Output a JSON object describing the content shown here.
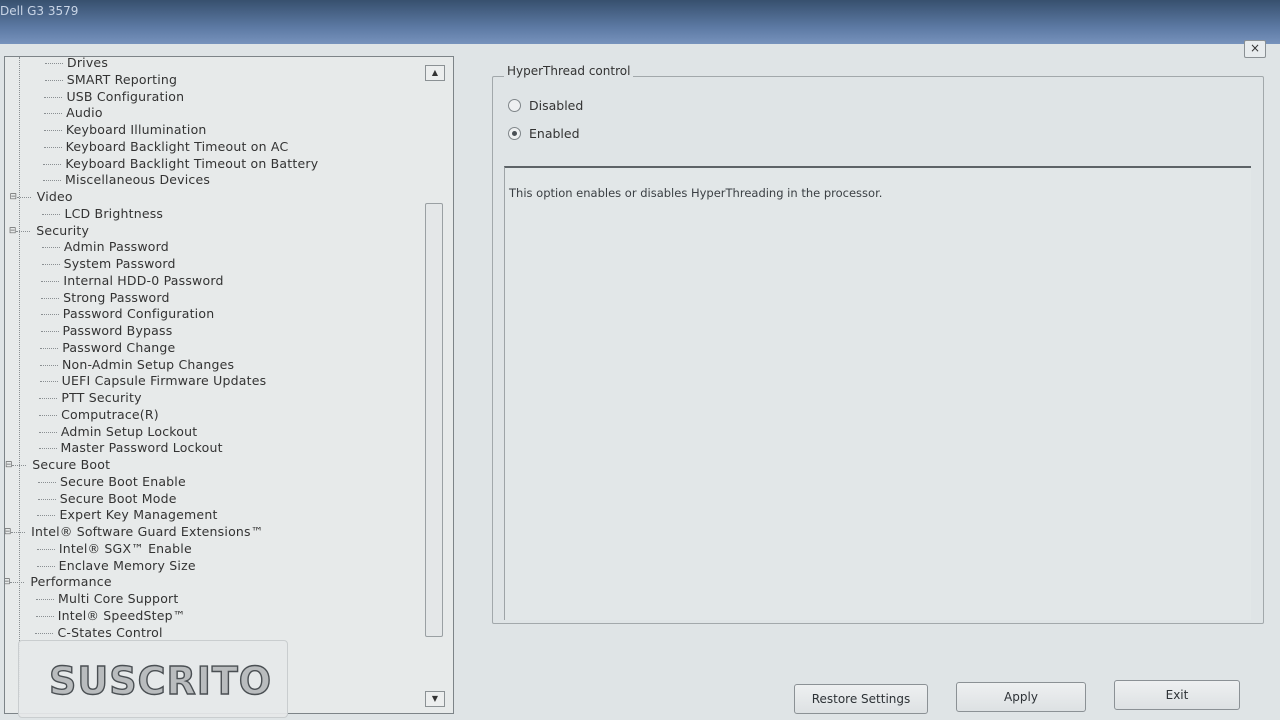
{
  "window": {
    "title": "Dell G3 3579",
    "close_glyph": "×"
  },
  "tree": {
    "items": [
      {
        "label": "Drives",
        "level": 2
      },
      {
        "label": "SMART Reporting",
        "level": 2
      },
      {
        "label": "USB Configuration",
        "level": 2
      },
      {
        "label": "Audio",
        "level": 2
      },
      {
        "label": "Keyboard Illumination",
        "level": 2
      },
      {
        "label": "Keyboard Backlight Timeout on AC",
        "level": 2
      },
      {
        "label": "Keyboard Backlight Timeout on Battery",
        "level": 2
      },
      {
        "label": "Miscellaneous Devices",
        "level": 2
      },
      {
        "label": "Video",
        "level": 1
      },
      {
        "label": "LCD Brightness",
        "level": 2
      },
      {
        "label": "Security",
        "level": 1
      },
      {
        "label": "Admin Password",
        "level": 2
      },
      {
        "label": "System Password",
        "level": 2
      },
      {
        "label": "Internal HDD-0 Password",
        "level": 2
      },
      {
        "label": "Strong Password",
        "level": 2
      },
      {
        "label": "Password Configuration",
        "level": 2
      },
      {
        "label": "Password Bypass",
        "level": 2
      },
      {
        "label": "Password Change",
        "level": 2
      },
      {
        "label": "Non-Admin Setup Changes",
        "level": 2
      },
      {
        "label": "UEFI Capsule Firmware Updates",
        "level": 2
      },
      {
        "label": "PTT Security",
        "level": 2
      },
      {
        "label": "Computrace(R)",
        "level": 2
      },
      {
        "label": "Admin Setup Lockout",
        "level": 2
      },
      {
        "label": "Master Password Lockout",
        "level": 2
      },
      {
        "label": "Secure Boot",
        "level": 1
      },
      {
        "label": "Secure Boot Enable",
        "level": 2
      },
      {
        "label": "Secure Boot Mode",
        "level": 2
      },
      {
        "label": "Expert Key Management",
        "level": 2
      },
      {
        "label": "Intel® Software Guard Extensions™",
        "level": 1
      },
      {
        "label": "Intel® SGX™ Enable",
        "level": 2
      },
      {
        "label": "Enclave Memory Size",
        "level": 2
      },
      {
        "label": "Performance",
        "level": 1
      },
      {
        "label": "Multi Core Support",
        "level": 2
      },
      {
        "label": "Intel® SpeedStep™",
        "level": 2
      },
      {
        "label": "C-States Control",
        "level": 2
      }
    ],
    "expander_glyph": "⊟",
    "scroll_up_glyph": "▲",
    "scroll_down_glyph": "▼"
  },
  "overlay": {
    "text": "SUSCRITO"
  },
  "option": {
    "group_title": "HyperThread control",
    "choices": [
      {
        "label": "Disabled",
        "selected": false
      },
      {
        "label": "Enabled",
        "selected": true
      }
    ],
    "description": "This option enables or disables HyperThreading in the processor."
  },
  "buttons": {
    "restore": "Restore Settings",
    "apply": "Apply",
    "exit": "Exit"
  }
}
